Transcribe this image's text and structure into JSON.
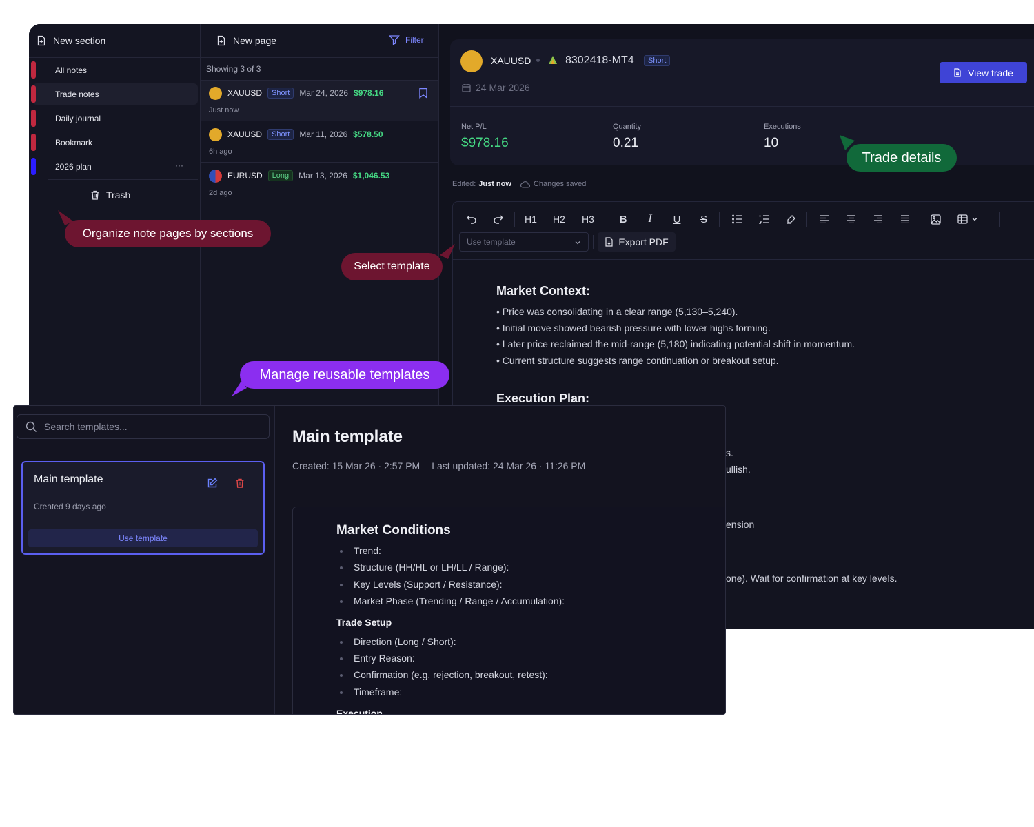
{
  "sections": {
    "header": "New section",
    "items": [
      {
        "label": "All notes",
        "color": "#c0283f"
      },
      {
        "label": "Trade notes",
        "color": "#c0283f"
      },
      {
        "label": "Daily journal",
        "color": "#c0283f"
      },
      {
        "label": "Bookmark",
        "color": "#c0283f"
      },
      {
        "label": "2026 plan",
        "color": "#2b1dff"
      }
    ],
    "more": "···",
    "trash": "Trash"
  },
  "pages": {
    "header": "New page",
    "filter": "Filter",
    "showing": "Showing 3 of 3",
    "notes": [
      {
        "symbol": "XAUUSD",
        "side": "Short",
        "date": "Mar 24, 2026",
        "amount": "$978.16",
        "time": "Just now"
      },
      {
        "symbol": "XAUUSD",
        "side": "Short",
        "date": "Mar 11, 2026",
        "amount": "$578.50",
        "time": "6h ago"
      },
      {
        "symbol": "EURUSD",
        "side": "Long",
        "date": "Mar 13, 2026",
        "amount": "$1,046.53",
        "time": "2d ago"
      }
    ]
  },
  "trade": {
    "symbol": "XAUUSD",
    "account": "8302418-MT4",
    "side": "Short",
    "date": "24 Mar 2026",
    "view_button": "View trade",
    "stats": [
      {
        "label": "Net P/L",
        "value": "$978.16"
      },
      {
        "label": "Quantity",
        "value": "0.21"
      },
      {
        "label": "Executions",
        "value": "10"
      }
    ]
  },
  "edit_status": {
    "prefix": "Edited:",
    "when": "Just now",
    "saved": "Changes saved"
  },
  "editor": {
    "toolbar": {
      "h1": "H1",
      "h2": "H2",
      "h3": "H3",
      "bold": "B",
      "italic": "I",
      "underline": "U",
      "strike": "S"
    },
    "template_select": "Use template",
    "export_pdf": "Export PDF",
    "market_context_title": "Market Context:",
    "market_context": [
      "• Price was consolidating in a clear range (5,130–5,240).",
      "• Initial move showed bearish pressure with lower highs forming.",
      "• Later price reclaimed the mid-range (5,180) indicating potential shift in momentum.",
      "• Current structure suggests range continuation or breakout setup."
    ],
    "execution_plan_title": "Execution Plan:",
    "peek": [
      "s.",
      "ullish.",
      "ension",
      "one). Wait for confirmation at key levels."
    ]
  },
  "callouts": {
    "sections": "Organize note pages by sections",
    "template": "Select template",
    "details": "Trade details",
    "reusable": "Manage reusable templates"
  },
  "templates": {
    "search_placeholder": "Search templates...",
    "card": {
      "name": "Main template",
      "created": "Created 9 days ago",
      "use": "Use template"
    },
    "detail": {
      "title": "Main template",
      "created": "Created: 15 Mar 26 · 2:57 PM",
      "updated": "Last updated: 24 Mar 26 · 11:26 PM"
    },
    "content": {
      "market_title": "Market Conditions",
      "market_items": [
        "Trend:",
        "Structure (HH/HL or LH/LL / Range):",
        "Key Levels (Support / Resistance):",
        "Market Phase (Trending / Range / Accumulation):"
      ],
      "setup_title": "Trade Setup",
      "setup_items": [
        "Direction (Long / Short):",
        "Entry Reason:",
        "Confirmation (e.g. rejection, breakout, retest):",
        "Timeframe:"
      ],
      "execution_title": "Execution"
    }
  }
}
